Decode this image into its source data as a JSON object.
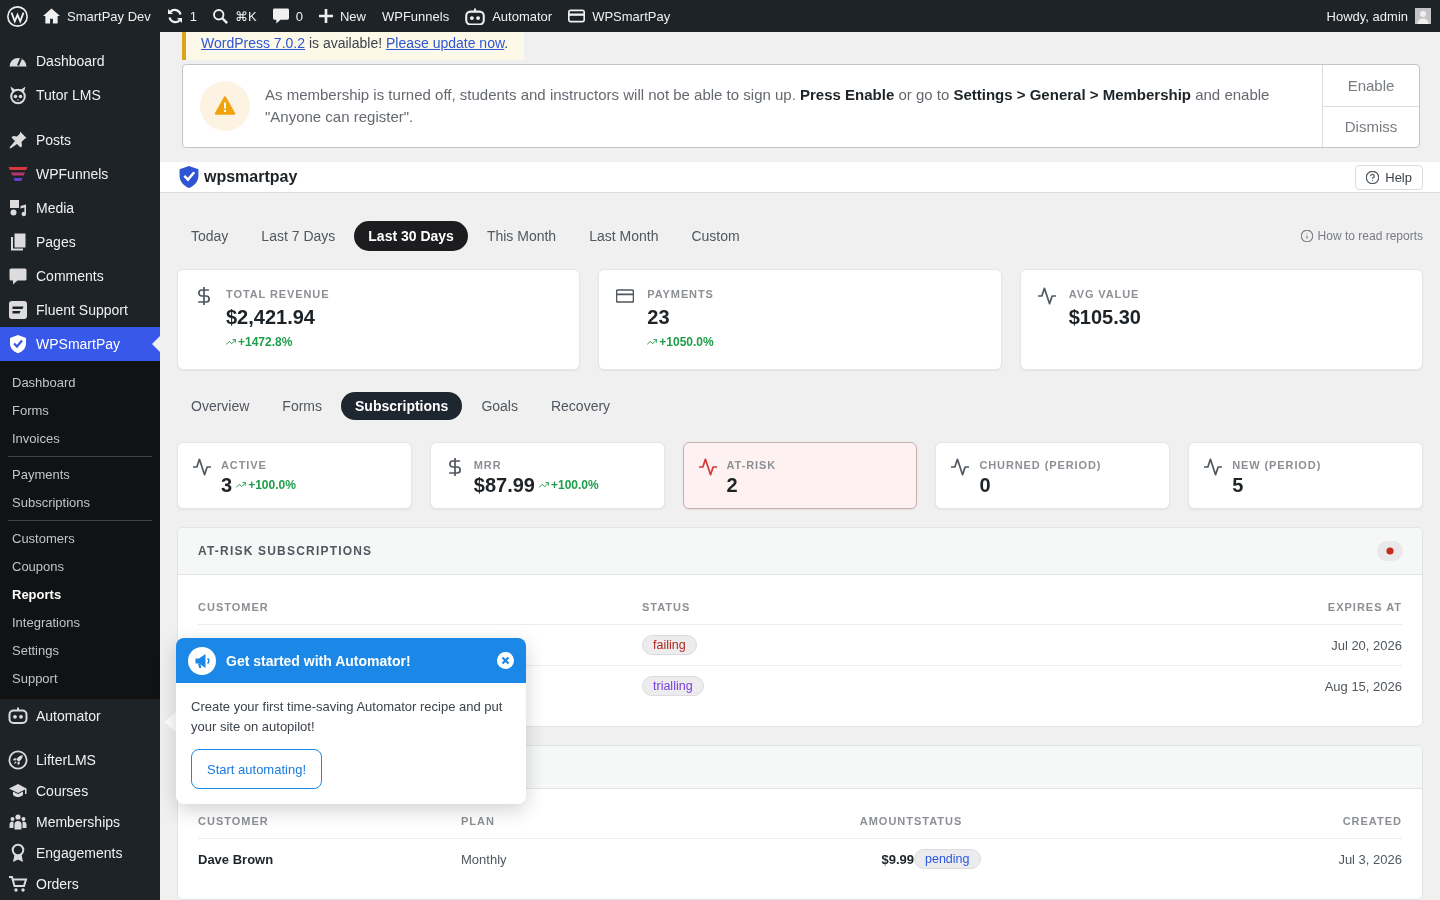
{
  "admin_bar": {
    "site": {
      "label": "SmartPay Dev"
    },
    "updates": {
      "count": "1"
    },
    "search": {
      "shortcut": "⌘K"
    },
    "comments": {
      "count": "0"
    },
    "new": {
      "label": "New"
    },
    "links": [
      {
        "label": "WPFunnels"
      },
      {
        "label": "Automator"
      },
      {
        "label": "WPSmartPay"
      }
    ],
    "account": {
      "greeting": "Howdy, admin"
    }
  },
  "sidebar": {
    "groups": [
      {
        "items": [
          {
            "label": "Dashboard",
            "selected": false
          },
          {
            "label": "Tutor LMS",
            "selected": false
          }
        ]
      },
      {
        "items": [
          {
            "label": "Posts",
            "selected": false
          },
          {
            "label": "WPFunnels",
            "selected": false
          },
          {
            "label": "Media",
            "selected": false
          },
          {
            "label": "Pages",
            "selected": false
          },
          {
            "label": "Comments",
            "selected": false
          },
          {
            "label": "Fluent Support",
            "selected": false
          },
          {
            "label": "WPSmartPay",
            "selected": true,
            "submenu": {
              "groups": [
                {
                  "items": [
                    {
                      "label": "Dashboard",
                      "selected": false
                    },
                    {
                      "label": "Forms",
                      "selected": false
                    },
                    {
                      "label": "Invoices",
                      "selected": false
                    }
                  ]
                },
                {
                  "items": [
                    {
                      "label": "Payments",
                      "selected": false
                    },
                    {
                      "label": "Subscriptions",
                      "selected": false
                    }
                  ]
                },
                {
                  "items": [
                    {
                      "label": "Customers",
                      "selected": false
                    },
                    {
                      "label": "Coupons",
                      "selected": false
                    },
                    {
                      "label": "Reports",
                      "selected": true
                    },
                    {
                      "label": "Integrations",
                      "selected": false
                    },
                    {
                      "label": "Settings",
                      "selected": false
                    },
                    {
                      "label": "Support",
                      "selected": false
                    }
                  ]
                }
              ]
            }
          },
          {
            "label": "Automator",
            "selected": false
          }
        ]
      },
      {
        "items": [
          {
            "label": "LifterLMS",
            "selected": false
          },
          {
            "label": "Courses",
            "selected": false
          },
          {
            "label": "Memberships",
            "selected": false
          },
          {
            "label": "Engagements",
            "selected": false
          },
          {
            "label": "Orders",
            "selected": false
          }
        ]
      }
    ]
  },
  "update_notice": {
    "parts": [
      {
        "kind": "link",
        "text": "WordPress 7.0.2"
      },
      {
        "kind": "text",
        "text": " is available! "
      },
      {
        "kind": "link",
        "text": "Please update now"
      },
      {
        "kind": "text",
        "text": "."
      }
    ]
  },
  "membership_notice": {
    "message": "As membership is turned off, students and instructors will not be able to sign up. **Press Enable** or go to **Settings > General > Membership** and enable \"Anyone can register\".",
    "buttons": [
      "Enable",
      "Dismiss"
    ]
  },
  "header": {
    "brand": "wpsmartpay",
    "help": "Help"
  },
  "date_range": {
    "tabs": [
      {
        "label": "Today",
        "selected": false
      },
      {
        "label": "Last 7 Days",
        "selected": false
      },
      {
        "label": "Last 30 Days",
        "selected": true
      },
      {
        "label": "This Month",
        "selected": false
      },
      {
        "label": "Last Month",
        "selected": false
      },
      {
        "label": "Custom",
        "selected": false
      }
    ],
    "help_link": "How to read reports"
  },
  "summary_cards": [
    {
      "label": "TOTAL REVENUE",
      "value": "$2,421.94",
      "change": "+1472.8%"
    },
    {
      "label": "PAYMENTS",
      "value": "23",
      "change": "+1050.0%"
    },
    {
      "label": "AVG VALUE",
      "value": "$105.30"
    }
  ],
  "report_tabs": [
    {
      "label": "Overview",
      "selected": false
    },
    {
      "label": "Forms",
      "selected": false
    },
    {
      "label": "Subscriptions",
      "selected": true
    },
    {
      "label": "Goals",
      "selected": false
    },
    {
      "label": "Recovery",
      "selected": false
    }
  ],
  "subscription_cards": [
    {
      "label": "ACTIVE",
      "value": "3",
      "change": "+100.0%",
      "alert": false
    },
    {
      "label": "MRR",
      "value": "$87.99",
      "change": "+100.0%",
      "alert": false
    },
    {
      "label": "AT-RISK",
      "value": "2",
      "alert": true
    },
    {
      "label": "CHURNED (PERIOD)",
      "value": "0",
      "alert": false
    },
    {
      "label": "NEW (PERIOD)",
      "value": "5",
      "alert": false
    }
  ],
  "at_risk_panel": {
    "title": "AT-RISK SUBSCRIPTIONS",
    "columns": [
      "CUSTOMER",
      "STATUS",
      "EXPIRES AT"
    ],
    "rows": [
      {
        "status": {
          "label": "failing",
          "color": "#b3261e"
        },
        "expires_at": "Jul 20, 2026"
      },
      {
        "status": {
          "label": "trialling",
          "color": "#7a3ddb"
        },
        "expires_at": "Aug 15, 2026"
      }
    ]
  },
  "recent_panel": {
    "columns": [
      "CUSTOMER",
      "PLAN",
      "AMOUNT",
      "STATUS",
      "CREATED"
    ],
    "rows": [
      {
        "customer": "Dave Brown",
        "plan": "Monthly",
        "amount": "$9.99",
        "status": {
          "label": "pending",
          "color": "#2b57e0"
        },
        "created": "Jul 3, 2026"
      }
    ]
  },
  "automator_popup": {
    "title": "Get started with Automator!",
    "body": "Create your first time-saving Automator recipe and put your site on autopilot!",
    "button": "Start automating!"
  }
}
